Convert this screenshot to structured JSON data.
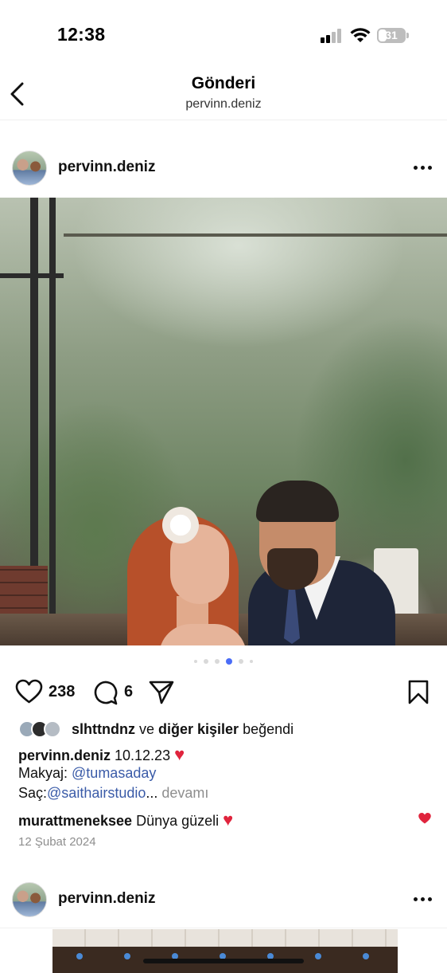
{
  "status_bar": {
    "time": "12:38",
    "battery": "31"
  },
  "nav": {
    "title": "Gönderi",
    "subtitle": "pervinn.deniz",
    "back_icon": "chevron-left-icon"
  },
  "post": {
    "username": "pervinn.deniz",
    "carousel": {
      "total": 6,
      "active_index": 3
    },
    "likes_count": "238",
    "comments_count": "6",
    "liked_by": {
      "user": "slhttndnz",
      "connector": " ve ",
      "others": "diğer kişiler",
      "suffix": " beğendi"
    },
    "caption": {
      "author": "pervinn.deniz",
      "text": " 10.12.23 ",
      "emoji": "♥",
      "makeup_label": "Makyaj: ",
      "makeup_mention": "@tumasaday",
      "hair_label": "Saç:",
      "hair_mention": "@saithairstudio",
      "ellipsis": "...",
      "more_label": " devamı"
    },
    "comment": {
      "user": "murattmeneksee",
      "text": " Dünya güzeli ",
      "emoji": "♥"
    },
    "date": "12 Şubat 2024"
  },
  "next_post": {
    "username": "pervinn.deniz"
  },
  "colors": {
    "accent": "#4a6cf7",
    "mention": "#3a5ba8",
    "heart": "#e0243d",
    "muted": "#8e8e8e"
  }
}
